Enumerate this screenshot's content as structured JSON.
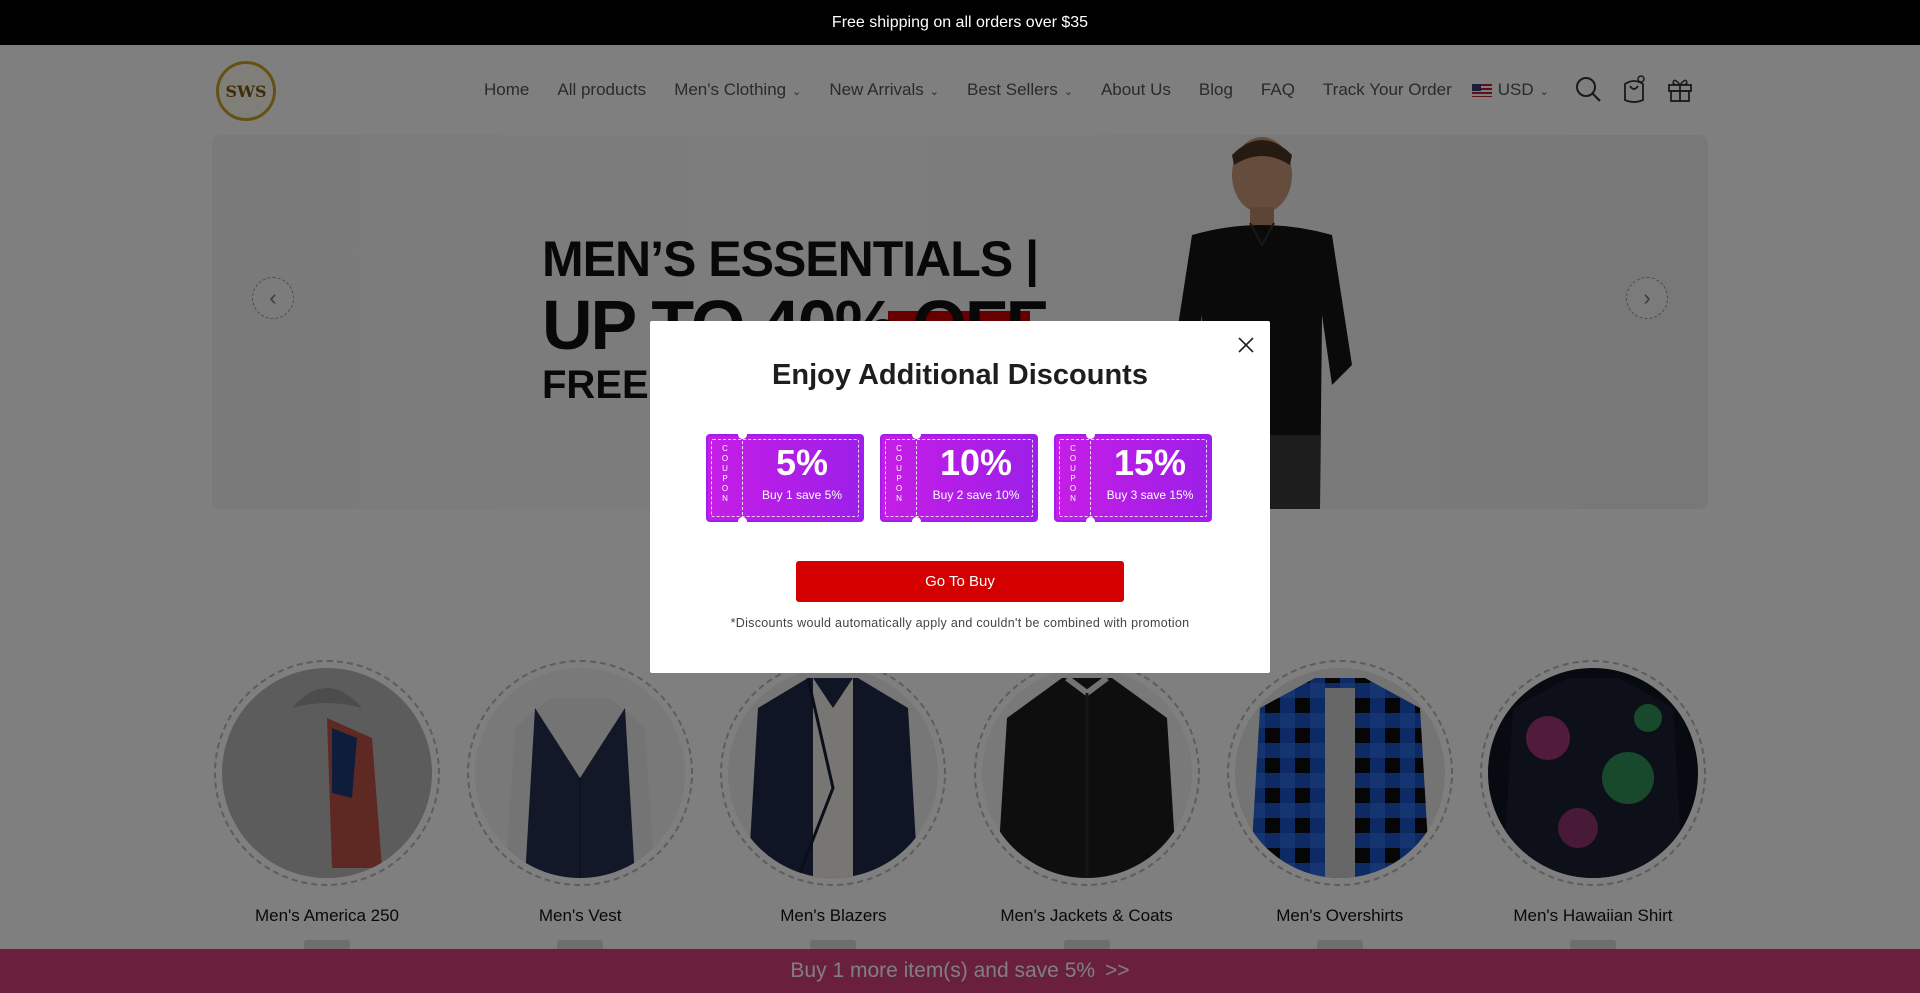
{
  "announcement": "Free shipping on all orders over $35",
  "logo": {
    "text": "SWS"
  },
  "nav": {
    "items": [
      {
        "label": "Home",
        "dropdown": false
      },
      {
        "label": "All products",
        "dropdown": false
      },
      {
        "label": "Men's Clothing",
        "dropdown": true
      },
      {
        "label": "New Arrivals",
        "dropdown": true
      },
      {
        "label": "Best Sellers",
        "dropdown": true
      },
      {
        "label": "About Us",
        "dropdown": false
      },
      {
        "label": "Blog",
        "dropdown": false
      },
      {
        "label": "FAQ",
        "dropdown": false
      },
      {
        "label": "Track Your Order",
        "dropdown": false
      }
    ],
    "currency": "USD",
    "icons": [
      "search-icon",
      "cart-icon",
      "gift-icon"
    ]
  },
  "hero": {
    "line1": "MEN’S ESSENTIALS |",
    "line2": "UP TO 40% OFF",
    "line3": "FREE S"
  },
  "categories": [
    {
      "name": "Men's America 250",
      "colors": [
        "#b9b9b9",
        "#c0392b",
        "#1f3a7a"
      ]
    },
    {
      "name": "Men's Vest",
      "colors": [
        "#24304f",
        "#e8e8ea",
        "#1a2440"
      ]
    },
    {
      "name": "Men's Blazers",
      "colors": [
        "#1e2a4a",
        "#f0ede6",
        "#141c33"
      ]
    },
    {
      "name": "Men's Jackets & Coats",
      "colors": [
        "#1c1c1c",
        "#e6e6e6",
        "#2a2a2a"
      ]
    },
    {
      "name": "Men's Overshirts",
      "colors": [
        "#1d55c8",
        "#0d0d0d",
        "#2b6be0"
      ]
    },
    {
      "name": "Men's Hawaiian Shirt",
      "colors": [
        "#0e1420",
        "#c43d8b",
        "#3ec46d"
      ]
    }
  ],
  "popup": {
    "title": "Enjoy Additional Discounts",
    "coupon_side_letters": [
      "C",
      "O",
      "U",
      "P",
      "O",
      "N"
    ],
    "coupons": [
      {
        "percent": "5%",
        "desc": "Buy 1 save 5%"
      },
      {
        "percent": "10%",
        "desc": "Buy 2 save 10%"
      },
      {
        "percent": "15%",
        "desc": "Buy 3 save 15%"
      }
    ],
    "button": "Go To Buy",
    "disclaimer": "*Discounts would automatically apply and couldn't be combined with promotion"
  },
  "bottom_bar": {
    "text": "Buy 1 more item(s) and save 5%",
    "arrow": ">>"
  },
  "colors": {
    "accent_red": "#d40000",
    "coupon_purple": "#b01fe8",
    "bottom_bar_pink": "#d4407a"
  }
}
